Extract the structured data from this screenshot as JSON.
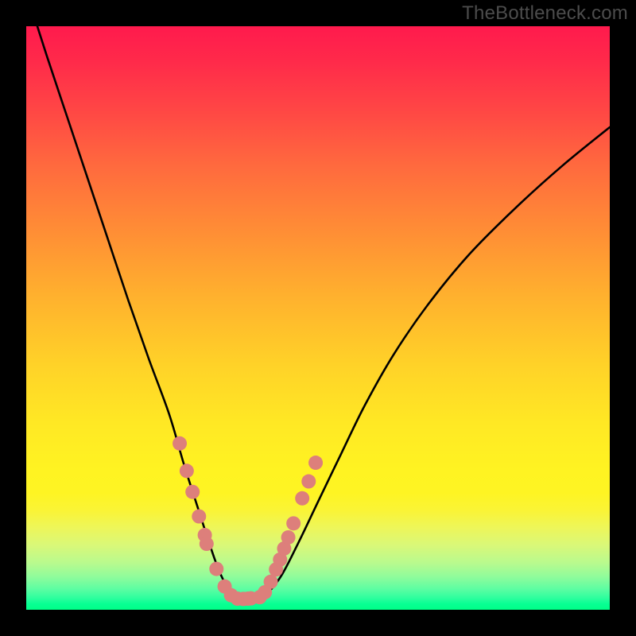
{
  "attribution": "TheBottleneck.com",
  "chart_data": {
    "type": "line",
    "title": "",
    "xlabel": "",
    "ylabel": "",
    "xlim": [
      0,
      100
    ],
    "ylim": [
      0,
      100
    ],
    "note": "V-shaped bottleneck curve over a vertical red→orange→yellow→green gradient. Axes and ticks are not rendered; values are estimated proportionally from the plot area.",
    "series": [
      {
        "name": "bottleneck-curve",
        "x": [
          0,
          3.5,
          7,
          10.5,
          14,
          17.5,
          21,
          24.5,
          27,
          29.4,
          31.5,
          33,
          34.5,
          36,
          37.5,
          40.5,
          43.5,
          46.5,
          50,
          54,
          58,
          63,
          69,
          76,
          84,
          92,
          100
        ],
        "y": [
          106,
          95,
          84.5,
          74,
          63.5,
          53,
          43,
          33.5,
          25,
          17.5,
          11,
          6.8,
          3.8,
          2.0,
          1.5,
          2.2,
          5.5,
          11.2,
          18.5,
          26.8,
          35,
          43.8,
          52.5,
          61,
          69,
          76.2,
          82.7
        ]
      }
    ],
    "markers": {
      "name": "highlight-dots",
      "color": "#dd7f7b",
      "radius_px": 9,
      "points_xy": [
        [
          26.3,
          28.5
        ],
        [
          27.5,
          23.8
        ],
        [
          28.5,
          20.2
        ],
        [
          29.6,
          16.0
        ],
        [
          30.6,
          12.8
        ],
        [
          30.9,
          11.3
        ],
        [
          32.6,
          7.0
        ],
        [
          34.0,
          4.0
        ],
        [
          35.1,
          2.5
        ],
        [
          36.2,
          1.9
        ],
        [
          37.2,
          1.85
        ],
        [
          38.0,
          1.9
        ],
        [
          38.5,
          1.95
        ],
        [
          40.0,
          2.15
        ],
        [
          40.9,
          3.0
        ],
        [
          41.9,
          4.8
        ],
        [
          42.8,
          6.9
        ],
        [
          43.5,
          8.6
        ],
        [
          44.2,
          10.5
        ],
        [
          44.9,
          12.4
        ],
        [
          45.8,
          14.8
        ],
        [
          47.3,
          19.1
        ],
        [
          48.4,
          22.0
        ],
        [
          49.6,
          25.2
        ]
      ]
    },
    "gradient_stops": [
      {
        "pos": 0.0,
        "color": "#ff1a4d"
      },
      {
        "pos": 0.24,
        "color": "#ff6a3e"
      },
      {
        "pos": 0.58,
        "color": "#ffd228"
      },
      {
        "pos": 0.8,
        "color": "#fef423"
      },
      {
        "pos": 1.0,
        "color": "#00ff88"
      }
    ]
  }
}
